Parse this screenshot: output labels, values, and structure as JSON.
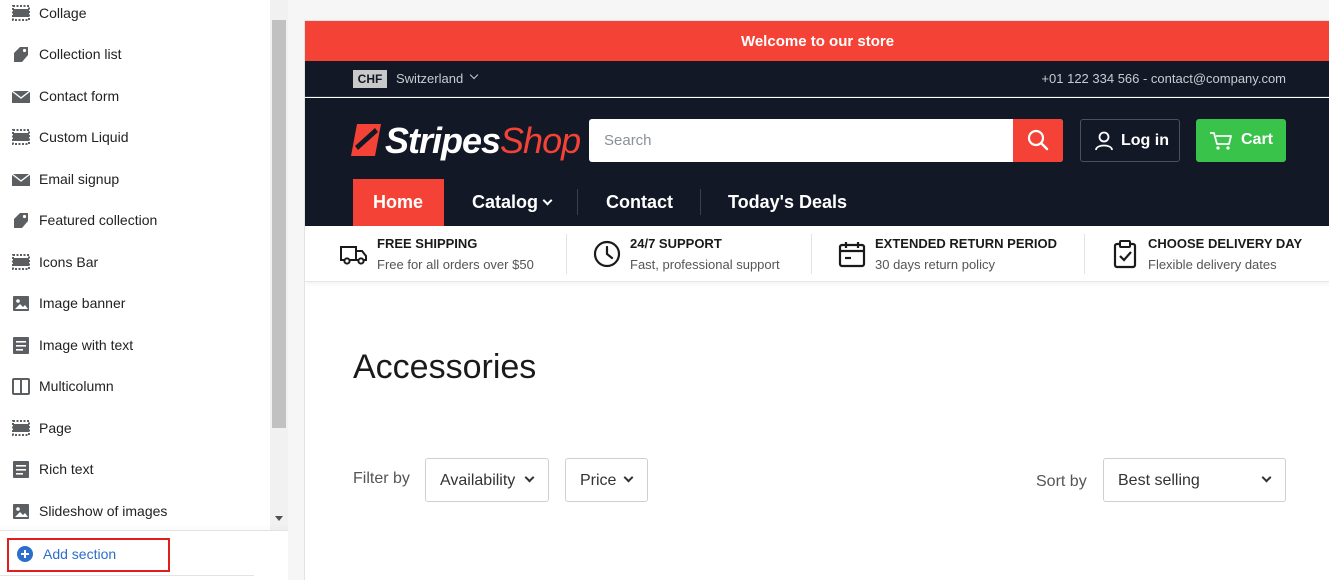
{
  "sidebar": {
    "sections": [
      {
        "label": "Collage",
        "icon": "layout-icon"
      },
      {
        "label": "Collection list",
        "icon": "tag-icon"
      },
      {
        "label": "Contact form",
        "icon": "envelope-icon"
      },
      {
        "label": "Custom Liquid",
        "icon": "layout-icon"
      },
      {
        "label": "Email signup",
        "icon": "envelope-icon"
      },
      {
        "label": "Featured collection",
        "icon": "tag-icon"
      },
      {
        "label": "Icons Bar",
        "icon": "layout-icon"
      },
      {
        "label": "Image banner",
        "icon": "image-icon"
      },
      {
        "label": "Image with text",
        "icon": "text-lines-icon"
      },
      {
        "label": "Multicolumn",
        "icon": "columns-icon"
      },
      {
        "label": "Page",
        "icon": "layout-icon"
      },
      {
        "label": "Rich text",
        "icon": "text-lines-icon"
      },
      {
        "label": "Slideshow of images",
        "icon": "image-icon"
      }
    ],
    "add_section_label": "Add section"
  },
  "store": {
    "announcement": "Welcome to our store",
    "currency": "CHF",
    "country": "Switzerland",
    "contact_info": "+01 122 334 566 - contact@company.com",
    "logo": {
      "part1": "Stripes",
      "part2": "Shop"
    },
    "search_placeholder": "Search",
    "login_label": "Log in",
    "cart_label": "Cart",
    "nav": {
      "home": "Home",
      "catalog": "Catalog",
      "contact": "Contact",
      "deals": "Today's Deals"
    },
    "features": [
      {
        "title": "FREE SHIPPING",
        "subtitle": "Free for all orders over $50",
        "icon": "truck-icon"
      },
      {
        "title": "24/7 SUPPORT",
        "subtitle": "Fast, professional support",
        "icon": "clock-icon"
      },
      {
        "title": "EXTENDED RETURN PERIOD",
        "subtitle": "30 days return policy",
        "icon": "calendar-icon"
      },
      {
        "title": "CHOOSE DELIVERY DAY",
        "subtitle": "Flexible delivery dates",
        "icon": "clipboard-check-icon"
      }
    ],
    "page_title": "Accessories",
    "filter_label": "Filter by",
    "filters": {
      "availability": "Availability",
      "price": "Price"
    },
    "sort_label": "Sort by",
    "sort_value": "Best selling"
  },
  "colors": {
    "brand_red": "#f44336",
    "header_dark": "#121826",
    "cart_green": "#3ac34b",
    "editor_link_blue": "#2c6ecb",
    "highlight_red": "#e01e1e"
  }
}
